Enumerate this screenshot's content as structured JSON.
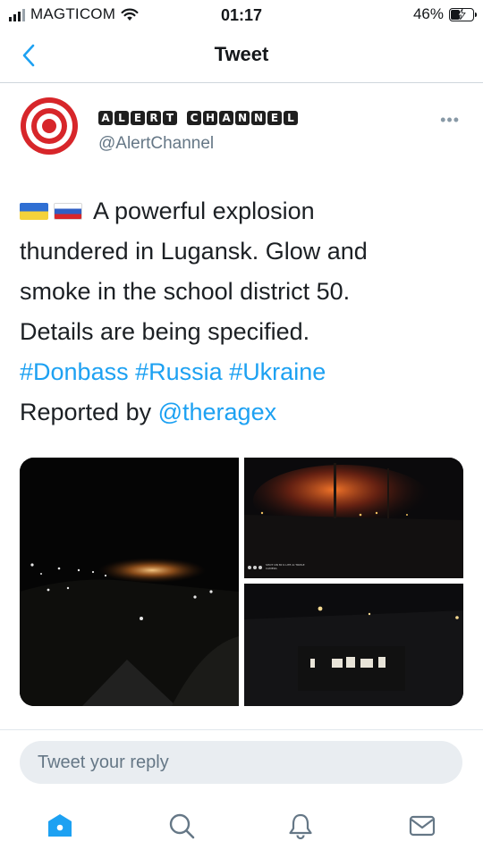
{
  "status_bar": {
    "carrier": "MAGTICOM",
    "time": "01:17",
    "battery_percent_label": "46%",
    "battery_level": 0.46
  },
  "header": {
    "title": "Tweet",
    "back_icon": "chevron-left-icon"
  },
  "tweet": {
    "display_name": "ALERT CHANNEL",
    "handle": "@AlertChannel",
    "more_icon": "more-horizontal-icon",
    "flags": [
      "ukraine-flag-icon",
      "russia-flag-icon"
    ],
    "lines": [
      "A powerful explosion",
      "thundered in Lugansk.  Glow and",
      "smoke in the school district 50.",
      "Details are being specified."
    ],
    "hashtags": [
      "#Donbass",
      "#Russia",
      "#Ukraine"
    ],
    "reported_by_label": "Reported by",
    "reported_by_mention": "@theragex",
    "media_count": 3,
    "photo_caption": "SHOT ON MI 9 LITE AI TRIPLE CAMERA"
  },
  "reply": {
    "placeholder": "Tweet your reply"
  },
  "tab_bar": {
    "items": [
      {
        "icon": "home-icon",
        "active": true
      },
      {
        "icon": "search-icon",
        "active": false
      },
      {
        "icon": "notifications-bell-icon",
        "active": false
      },
      {
        "icon": "messages-envelope-icon",
        "active": false
      }
    ]
  },
  "colors": {
    "accent": "#1da1f2",
    "text": "#14171a",
    "muted": "#657786",
    "avatar_red": "#d7262a"
  }
}
